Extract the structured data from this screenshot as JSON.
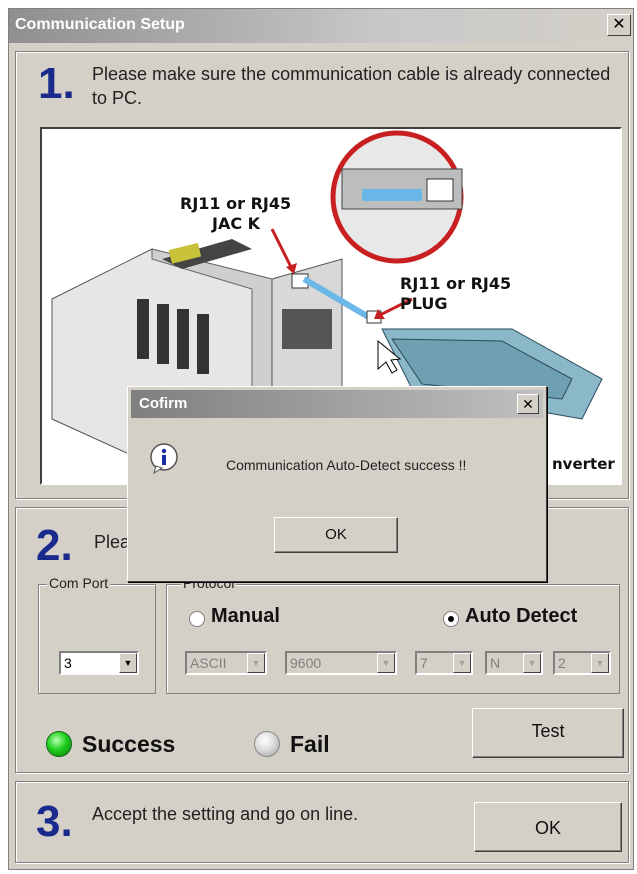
{
  "window": {
    "title": "Communication Setup",
    "close_glyph": "✕"
  },
  "step1": {
    "number": "1",
    "text": "Please make sure the communication cable is already connected to PC.",
    "picture": {
      "label_jack_line1": "RJ11 or RJ45",
      "label_jack_line2": "JAC K",
      "label_plug_line1": "RJ11 or RJ45",
      "label_plug_line2": "PLUG",
      "label_converter": "nverter"
    }
  },
  "step2": {
    "number": "2",
    "text_visible": "Plea",
    "com_port": {
      "legend": "Com Port",
      "value": "3"
    },
    "protocol": {
      "legend": "Protocol",
      "manual_label": "Manual",
      "auto_label": "Auto Detect",
      "selected": "Auto Detect",
      "fields": [
        "ASCII",
        "9600",
        "7",
        "N",
        "2"
      ]
    },
    "status": {
      "success_label": "Success",
      "fail_label": "Fail",
      "success_color": "#1ecf1e"
    },
    "test_label": "Test"
  },
  "step3": {
    "number": "3",
    "text": "Accept the setting and go on line.",
    "ok_label": "OK"
  },
  "dialog": {
    "title": "Cofirm",
    "close_glyph": "✕",
    "icon": "info-icon",
    "message": "Communication Auto-Detect success !!",
    "ok_label": "OK"
  }
}
